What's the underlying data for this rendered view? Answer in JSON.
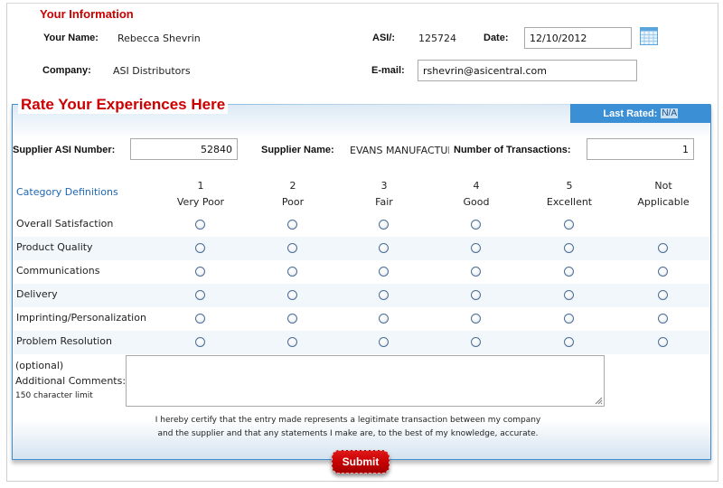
{
  "your_info": {
    "title": "Your Information",
    "name_label": "Your Name:",
    "name_value": "Rebecca Shevrin",
    "company_label": "Company:",
    "company_value": "ASI Distributors",
    "asi_label": "ASI/:",
    "asi_value": "125724",
    "date_label": "Date:",
    "date_value": "12/10/2012",
    "calendar_icon": "calendar-icon",
    "email_label": "E-mail:",
    "email_value": "rshevrin@asicentral.com"
  },
  "rating": {
    "title": "Rate Your Experiences Here",
    "last_rated_label": "Last Rated:",
    "last_rated_value": "N/A",
    "supplier_asi_label": "Supplier ASI Number:",
    "supplier_asi_value": "52840",
    "supplier_name_label": "Supplier Name:",
    "supplier_name_value": "EVANS MANUFACTUI",
    "transactions_label": "Number of Transactions:",
    "transactions_value": "1",
    "category_definitions_link": "Category Definitions",
    "columns": [
      {
        "num": "1",
        "label": "Very Poor"
      },
      {
        "num": "2",
        "label": "Poor"
      },
      {
        "num": "3",
        "label": "Fair"
      },
      {
        "num": "4",
        "label": "Good"
      },
      {
        "num": "5",
        "label": "Excellent"
      },
      {
        "num": "Not",
        "label": "Applicable"
      }
    ],
    "categories": [
      {
        "label": "Overall Satisfaction",
        "has_na": false
      },
      {
        "label": "Product Quality",
        "has_na": true
      },
      {
        "label": "Communications",
        "has_na": true
      },
      {
        "label": "Delivery",
        "has_na": true
      },
      {
        "label": "Imprinting/Personalization",
        "has_na": true
      },
      {
        "label": "Problem Resolution",
        "has_na": true
      }
    ],
    "comments": {
      "optional": "(optional)",
      "label": "Additional Comments:",
      "limit": "150 character limit",
      "value": ""
    },
    "certify_line1": "I hereby certify that the entry made represents a legitimate transaction between my company",
    "certify_line2": "and the supplier and that any statements I make are, to the best of my knowledge, accurate.",
    "submit_label": "Submit"
  },
  "colors": {
    "title_red": "#cc0000",
    "panel_blue": "#3b8fd4",
    "link_blue": "#1e66b4"
  }
}
